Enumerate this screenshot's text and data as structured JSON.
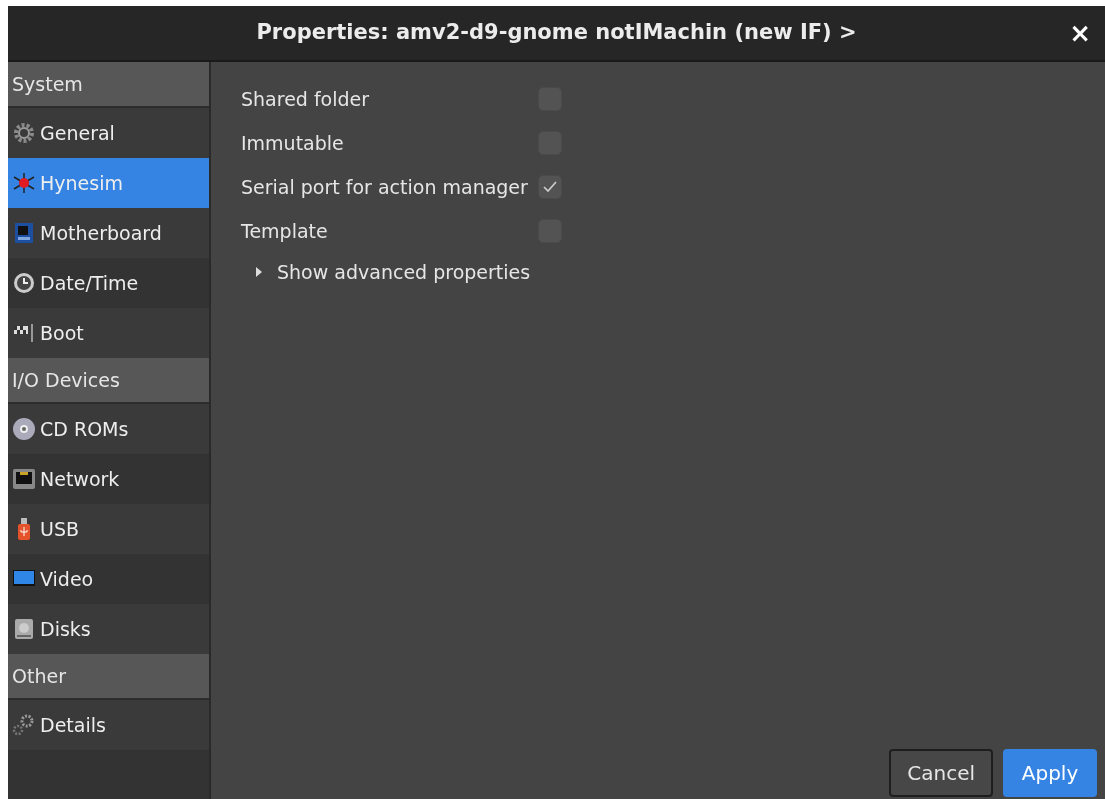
{
  "window": {
    "title": "Properties: amv2-d9-gnome notIMachin (new IF) >",
    "close": "×"
  },
  "sidebar": {
    "items": [
      {
        "kind": "header",
        "label": "System"
      },
      {
        "kind": "item",
        "label": "General",
        "selected": false
      },
      {
        "kind": "item",
        "label": "Hynesim",
        "selected": true
      },
      {
        "kind": "item",
        "label": "Motherboard",
        "selected": false
      },
      {
        "kind": "item",
        "label": "Date/Time",
        "selected": false
      },
      {
        "kind": "item",
        "label": "Boot",
        "selected": false
      },
      {
        "kind": "header",
        "label": "I/O Devices"
      },
      {
        "kind": "item",
        "label": "CD ROMs",
        "selected": false
      },
      {
        "kind": "item",
        "label": "Network",
        "selected": false
      },
      {
        "kind": "item",
        "label": "USB",
        "selected": false
      },
      {
        "kind": "item",
        "label": "Video",
        "selected": false
      },
      {
        "kind": "item",
        "label": "Disks",
        "selected": false
      },
      {
        "kind": "header",
        "label": "Other"
      },
      {
        "kind": "item",
        "label": "Details",
        "selected": false
      }
    ]
  },
  "properties": [
    {
      "label": "Shared folder",
      "checked": false
    },
    {
      "label": "Immutable",
      "checked": false
    },
    {
      "label": "Serial port for action manager",
      "checked": true
    },
    {
      "label": "Template",
      "checked": false
    }
  ],
  "advanced": {
    "label": "Show advanced properties",
    "expanded": false
  },
  "buttons": [
    {
      "label": "Cancel",
      "kind": "secondary"
    },
    {
      "label": "Apply",
      "kind": "primary"
    }
  ]
}
